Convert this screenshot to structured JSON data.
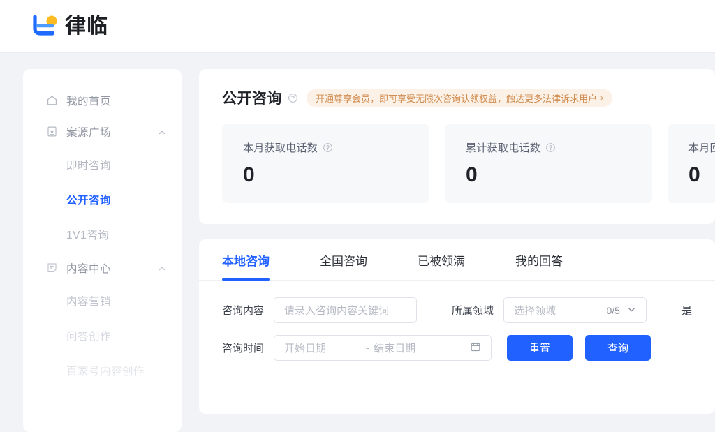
{
  "header": {
    "brand_name": "律临",
    "logo_icon": "lvlin-logo-icon"
  },
  "sidebar": {
    "items": [
      {
        "label": "我的首页",
        "icon": "home-icon",
        "type": "item",
        "active": false
      },
      {
        "label": "案源广场",
        "icon": "case-square-icon",
        "type": "group",
        "expanded": true,
        "caret": "chevron-up-icon"
      },
      {
        "label": "即时咨询",
        "type": "sub",
        "active": false
      },
      {
        "label": "公开咨询",
        "type": "sub",
        "active": true
      },
      {
        "label": "1V1咨询",
        "type": "sub",
        "active": false
      },
      {
        "label": "内容中心",
        "icon": "content-center-icon",
        "type": "group",
        "expanded": true,
        "caret": "chevron-up-icon"
      },
      {
        "label": "内容营销",
        "type": "sub",
        "active": false
      },
      {
        "label": "问答创作",
        "type": "sub",
        "active": false
      },
      {
        "label": "百家号内容创作",
        "type": "sub",
        "active": false
      }
    ]
  },
  "stats_panel": {
    "title": "公开咨询",
    "title_help_icon": "question-circle-icon",
    "promo": {
      "text": "开通尊享会员，即可享受无限次咨询认领权益，触达更多法律诉求用户",
      "arrow": "›",
      "bg_color": "#FCF1E6",
      "text_color": "#D08B4E"
    },
    "cards": [
      {
        "label": "本月获取电话数",
        "value": "0",
        "help_icon": "question-circle-icon"
      },
      {
        "label": "累计获取电话数",
        "value": "0",
        "help_icon": "question-circle-icon"
      },
      {
        "label": "本月回",
        "value": "0",
        "help_icon": "question-circle-icon"
      }
    ]
  },
  "list_panel": {
    "tabs": [
      {
        "label": "本地咨询",
        "active": true
      },
      {
        "label": "全国咨询",
        "active": false
      },
      {
        "label": "已被领满",
        "active": false
      },
      {
        "label": "我的回答",
        "active": false
      }
    ],
    "filters": {
      "keyword_label": "咨询内容",
      "keyword_placeholder": "请录入咨询内容关键词",
      "keyword_value": "",
      "domain_label": "所属领域",
      "domain_placeholder": "选择领域",
      "domain_counter": "0/5",
      "domain_caret": "chevron-down-icon",
      "truncated_label": "是",
      "time_label": "咨询时间",
      "date_start_placeholder": "开始日期",
      "date_separator": "~",
      "date_end_placeholder": "结束日期",
      "calendar_icon": "calendar-icon",
      "reset_button": "重置",
      "query_button": "查询",
      "button_color": "#2161FF"
    }
  }
}
